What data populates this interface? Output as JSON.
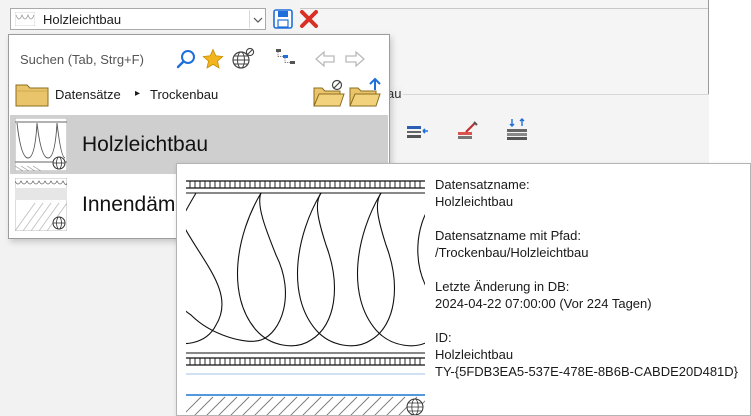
{
  "selector": {
    "value": "Holzleichtbau"
  },
  "background": {
    "group_label": "au"
  },
  "dropdown": {
    "search_placeholder": "Suchen (Tab, Strg+F)",
    "breadcrumb": {
      "root": "Datensätze",
      "separator": "▸",
      "current": "Trockenbau"
    },
    "items": [
      {
        "label": "Holzleichtbau",
        "selected": true
      },
      {
        "label": "Innendäm",
        "selected": false
      }
    ]
  },
  "tooltip": {
    "name_label": "Datensatzname:",
    "name_value": "Holzleichtbau",
    "path_label": "Datensatzname mit Pfad:",
    "path_value": "/Trockenbau/Holzleichtbau",
    "changed_label": "Letzte Änderung in DB:",
    "changed_value": "2024-04-22 07:00:00 (Vor 224 Tagen)",
    "id_label": "ID:",
    "id_value": "Holzleichtbau",
    "id_guid": "TY-{5FDB3EA5-537E-478E-8B6B-CABDE20D481D}"
  },
  "colors": {
    "accent_blue": "#1e6fd9",
    "selected_bg": "#cfcfcf",
    "folder_yellow": "#e9c46a",
    "delete_red": "#d93025"
  },
  "icons": {
    "search": "search-icon",
    "favorite": "star-icon",
    "database": "globe-lock-icon",
    "tree": "tree-icon",
    "back": "back-arrow-icon",
    "forward": "forward-arrow-icon",
    "save": "save-icon",
    "delete": "delete-icon"
  }
}
